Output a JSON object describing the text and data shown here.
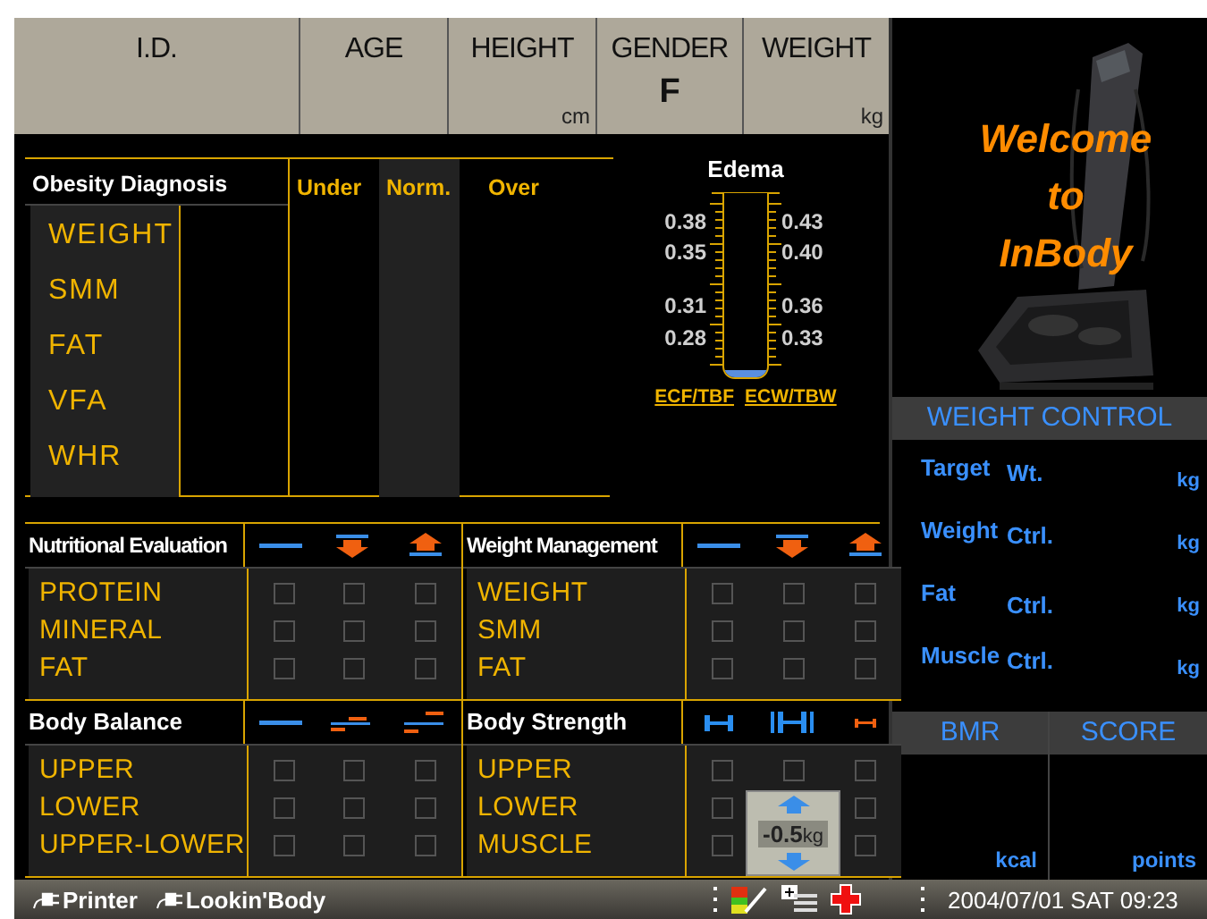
{
  "header": [
    {
      "label": "I.D."
    },
    {
      "label": "AGE"
    },
    {
      "label": "HEIGHT",
      "unit": "cm"
    },
    {
      "label": "GENDER",
      "value": "F"
    },
    {
      "label": "WEIGHT",
      "unit": "kg"
    }
  ],
  "obesity": {
    "title": "Obesity Diagnosis",
    "items": [
      "WEIGHT",
      "SMM",
      "FAT",
      "VFA",
      "WHR"
    ],
    "columns": [
      {
        "label": "Under",
        "selected": false
      },
      {
        "label": "Norm.",
        "selected": true
      },
      {
        "label": "Over",
        "selected": false
      }
    ]
  },
  "edema": {
    "title": "Edema",
    "left_ticks": [
      "0.38",
      "0.35",
      "0.31",
      "0.28"
    ],
    "right_ticks": [
      "0.43",
      "0.40",
      "0.36",
      "0.33"
    ],
    "left_label": "ECF/TBF",
    "right_label": "ECW/TBW",
    "level": 0.04
  },
  "sections": [
    {
      "title": "Nutritional Evaluation",
      "kind": "nutrition",
      "rows": [
        {
          "label": "PROTEIN",
          "checks": {
            "column_1": false,
            "column_2": false,
            "column_3": false
          }
        },
        {
          "label": "MINERAL",
          "checks": {
            "column_1": false,
            "column_2": false,
            "column_3": false
          }
        },
        {
          "label": "FAT",
          "checks": {
            "column_1": false,
            "column_2": false,
            "column_3": false
          }
        }
      ]
    },
    {
      "title": "Weight Management",
      "kind": "nutrition",
      "rows": [
        {
          "label": "WEIGHT",
          "checks": {
            "column_1": false,
            "column_2": false,
            "column_3": false
          }
        },
        {
          "label": "SMM",
          "checks": {
            "column_1": false,
            "column_2": false,
            "column_3": false
          }
        },
        {
          "label": "FAT",
          "checks": {
            "column_1": false,
            "column_2": false,
            "column_3": false
          }
        }
      ]
    },
    {
      "title": "Body Balance",
      "kind": "balance",
      "rows": [
        {
          "label": "UPPER",
          "checks": {
            "column_1": false,
            "column_2": false,
            "column_3": false
          }
        },
        {
          "label": "LOWER",
          "checks": {
            "column_1": false,
            "column_2": false,
            "column_3": false
          }
        },
        {
          "label": "UPPER-LOWER",
          "checks": {
            "column_1": false,
            "column_2": false,
            "column_3": false
          }
        }
      ]
    },
    {
      "title": "Body Strength",
      "kind": "strength",
      "rows": [
        {
          "label": "UPPER",
          "checks": {
            "column_1": false,
            "column_2": false,
            "column_3": false
          }
        },
        {
          "label": "LOWER",
          "checks": {
            "column_1": false,
            "column_3": false
          }
        },
        {
          "label": "MUSCLE",
          "checks": {
            "column_1": false,
            "column_3": false
          }
        }
      ]
    }
  ],
  "welcome": [
    "Welcome",
    "to",
    "InBody"
  ],
  "weight_control": {
    "title": "WEIGHT CONTROL",
    "rows": [
      {
        "label": "Target",
        "label2": "Wt.",
        "unit": "kg"
      },
      {
        "label": "Weight",
        "label2": "Ctrl.",
        "unit": "kg"
      },
      {
        "label": "Fat",
        "label2": "Ctrl.",
        "unit": "kg"
      },
      {
        "label": "Muscle",
        "label2": "Ctrl.",
        "unit": "kg"
      }
    ]
  },
  "results": [
    {
      "title": "BMR",
      "unit": "kcal"
    },
    {
      "title": "SCORE",
      "unit": "points"
    }
  ],
  "adjuster": {
    "value": "-0.5",
    "unit": "kg"
  },
  "status_bar": {
    "links": [
      "Printer",
      "Lookin'Body"
    ],
    "datetime": "2004/07/01 SAT 09:23"
  }
}
